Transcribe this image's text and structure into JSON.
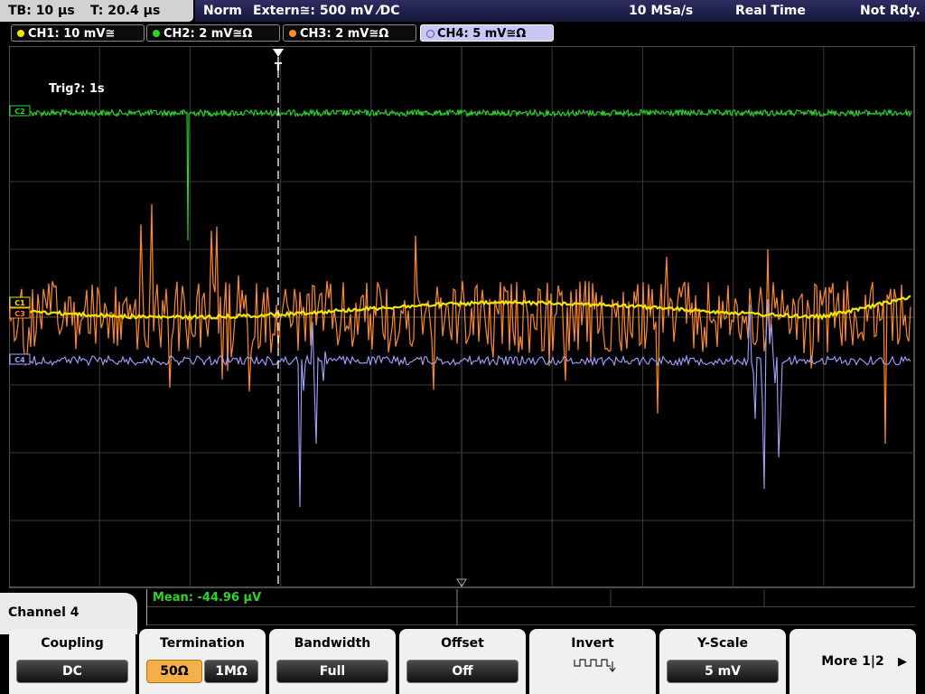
{
  "status_bar": {
    "timebase": "TB: 10 µs",
    "trigger_pos": "T: 20.4 µs",
    "trigger_mode": "Norm",
    "trigger_source": "Extern≅: 500 mV ⁄DC",
    "sample_rate": "10 MSa/s",
    "acq_mode": "Real Time",
    "state": "Not Rdy."
  },
  "channels": [
    {
      "label": "CH1: 10 mV≅",
      "color": "#f2e600"
    },
    {
      "label": "CH2: 2 mV≅Ω",
      "color": "#2bd62b"
    },
    {
      "label": "CH3: 2 mV≅Ω",
      "color": "#ff8a2a"
    },
    {
      "label": "CH4: 5 mV≅Ω",
      "color": "#a3a3ff"
    }
  ],
  "screen": {
    "trig_info": "Trig?: 1s",
    "trigger_marker": "T",
    "ch1_marker": "C1",
    "ch2_marker": "C2",
    "ch3_marker": "C3",
    "ch4_marker": "C4"
  },
  "measurement": {
    "text": "Mean: -44.96 µV"
  },
  "menu": {
    "title": "Channel 4",
    "coupling": {
      "title": "Coupling",
      "value": "DC"
    },
    "termination": {
      "title": "Termination",
      "opt1": "50Ω",
      "opt2": "1MΩ"
    },
    "bandwidth": {
      "title": "Bandwidth",
      "value": "Full"
    },
    "offset": {
      "title": "Offset",
      "value": "Off"
    },
    "invert": {
      "title": "Invert",
      "icon": "invert-square-wave-icon"
    },
    "yscale": {
      "title": "Y-Scale",
      "value": "5 mV"
    },
    "more": {
      "label": "More 1|2",
      "icon": "play-arrow-icon"
    }
  }
}
